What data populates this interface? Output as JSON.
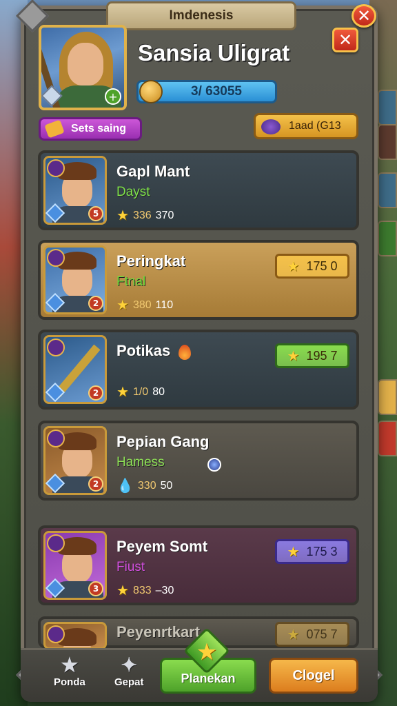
{
  "header": {
    "title": "Imdenesis",
    "close_label": "✕"
  },
  "hero": {
    "name": "Sansia Uligrat",
    "xp_text": "3/ 63055",
    "tag_label": "Sets saing",
    "currency_text": "1aad (G13"
  },
  "cards": [
    {
      "name": "Gapl Mant",
      "subtitle": "Dayst",
      "subtitle_color": "#7ee04a",
      "stat_icon": "★",
      "stat_value": "336",
      "stat_extra": "370",
      "level": "5",
      "reward": "",
      "theme": "slate"
    },
    {
      "name": "Peringkat",
      "subtitle": "Ftnal",
      "subtitle_color": "#6edc3a",
      "stat_icon": "★",
      "stat_value": "380",
      "stat_extra": "110",
      "level": "2",
      "reward": "175 0",
      "theme": "gold"
    },
    {
      "name": "Potikas",
      "subtitle": "",
      "subtitle_color": "#ffffff",
      "stat_icon": "★",
      "stat_value": "1/0",
      "stat_extra": "80",
      "level": "2",
      "reward": "195 7",
      "theme": "slate"
    },
    {
      "name": "Pepian Gang",
      "subtitle": "Hamess",
      "subtitle_color": "#8ee056",
      "stat_icon": "💧",
      "stat_value": "330",
      "stat_extra": "50",
      "level": "2",
      "reward": "",
      "theme": "stone"
    },
    {
      "name": "Peyem Somt",
      "subtitle": "Fiust",
      "subtitle_color": "#d64fe0",
      "stat_icon": "★",
      "stat_value": "833",
      "stat_extra": "–30",
      "level": "3",
      "reward": "175 3",
      "theme": "purple"
    },
    {
      "name": "Peyenrtkart",
      "subtitle": "",
      "subtitle_color": "#ffffff",
      "stat_icon": "★",
      "stat_value": "",
      "stat_extra": "",
      "level": "",
      "reward": "075 7",
      "theme": "stone"
    }
  ],
  "nav": {
    "item1": "Ponda",
    "item2": "Gepat",
    "primary": "Planekan",
    "secondary": "Clogel"
  }
}
